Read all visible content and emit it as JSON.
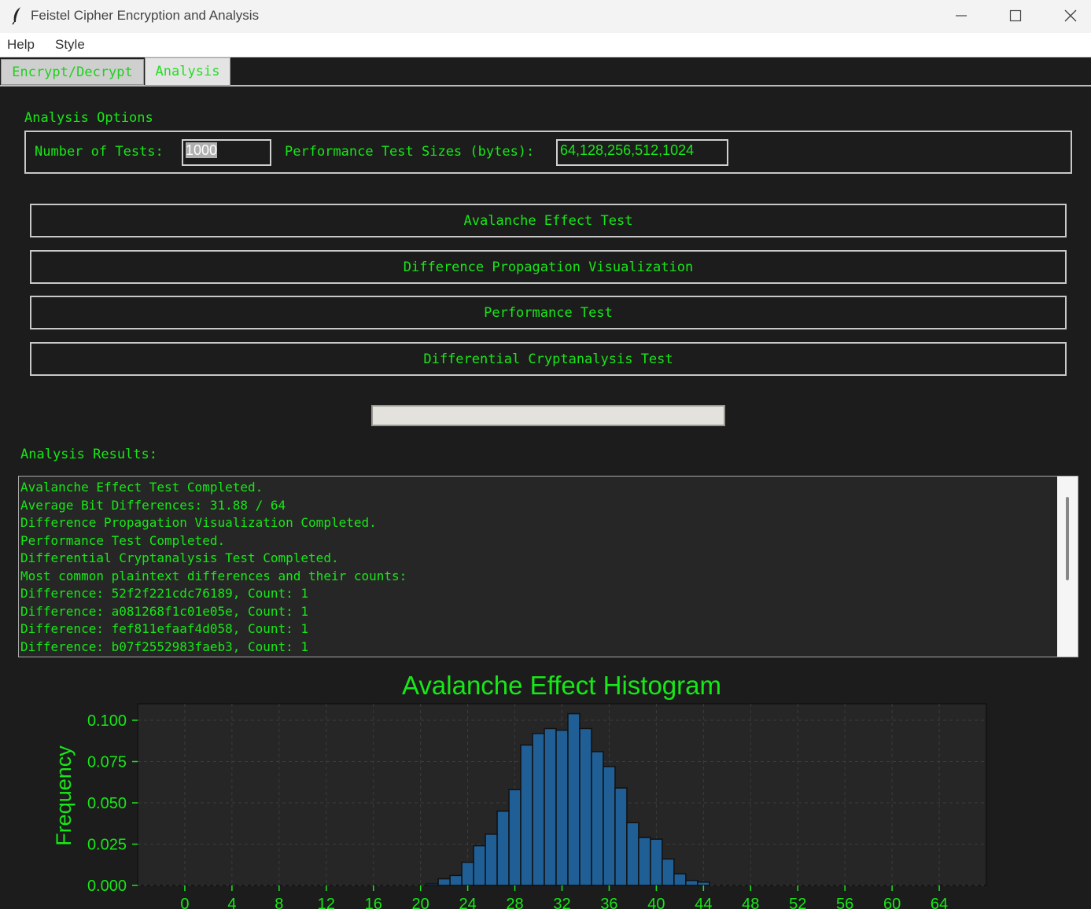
{
  "window": {
    "title": "Feistel Cipher Encryption and Analysis"
  },
  "menu": [
    "Help",
    "Style"
  ],
  "tabs": [
    {
      "label": "Encrypt/Decrypt",
      "active": false
    },
    {
      "label": "Analysis",
      "active": true
    }
  ],
  "options": {
    "section_label": "Analysis Options",
    "num_tests_label": "Number of Tests:",
    "num_tests_value": "1000",
    "perf_sizes_label": "Performance Test Sizes (bytes):",
    "perf_sizes_value": "64,128,256,512,1024"
  },
  "buttons": {
    "avalanche": "Avalanche Effect Test",
    "diff_prop": "Difference Propagation Visualization",
    "performance": "Performance Test",
    "differential": "Differential Cryptanalysis Test"
  },
  "progress": 0,
  "results": {
    "label": "Analysis Results:",
    "lines": [
      "Avalanche Effect Test Completed.",
      "Average Bit Differences: 31.88 / 64",
      "Difference Propagation Visualization Completed.",
      "Performance Test Completed.",
      "Differential Cryptanalysis Test Completed.",
      "Most common plaintext differences and their counts:",
      "Difference: 52f2f221cdc76189, Count: 1",
      "Difference: a081268f1c01e05e, Count: 1",
      "Difference: fef811efaaf4d058, Count: 1",
      "Difference: b07f2552983faeb3, Count: 1"
    ]
  },
  "colors": {
    "accent": "#17e817",
    "background": "#1c1c1c",
    "bar": "#1f5f96"
  },
  "chart_data": {
    "type": "bar",
    "title": "Avalanche Effect Histogram",
    "xlabel": "",
    "ylabel": "Frequency",
    "xlim": [
      -4,
      68
    ],
    "ylim": [
      0,
      0.11
    ],
    "xticks": [
      0,
      4,
      8,
      12,
      16,
      20,
      24,
      28,
      32,
      36,
      40,
      44,
      48,
      52,
      56,
      60,
      64
    ],
    "yticks": [
      0.0,
      0.025,
      0.05,
      0.075,
      0.1
    ],
    "ytick_labels": [
      "0.000",
      "0.025",
      "0.050",
      "0.075",
      "0.100"
    ],
    "grid": true,
    "x": [
      21,
      22,
      23,
      24,
      25,
      26,
      27,
      28,
      29,
      30,
      31,
      32,
      33,
      34,
      35,
      36,
      37,
      38,
      39,
      40,
      41,
      42,
      43,
      44
    ],
    "values": [
      0.001,
      0.004,
      0.006,
      0.014,
      0.024,
      0.031,
      0.045,
      0.058,
      0.085,
      0.092,
      0.095,
      0.094,
      0.104,
      0.095,
      0.081,
      0.072,
      0.059,
      0.038,
      0.029,
      0.028,
      0.016,
      0.007,
      0.003,
      0.002
    ]
  }
}
